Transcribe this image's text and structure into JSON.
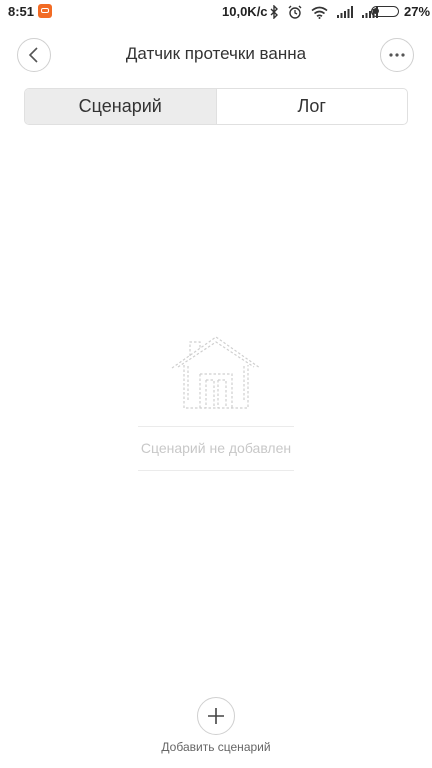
{
  "status_bar": {
    "time": "8:51",
    "network_speed": "10,0K/c",
    "battery_percent": "27%",
    "icons": [
      "app-notification-icon",
      "bluetooth-icon",
      "alarm-icon",
      "wifi-icon",
      "signal-icon",
      "signal-icon",
      "battery-icon"
    ]
  },
  "header": {
    "title": "Датчик протечки ванна",
    "back_icon": "chevron-left-icon",
    "more_icon": "more-dots-icon"
  },
  "tabs": [
    {
      "label": "Сценарий",
      "active": true
    },
    {
      "label": "Лог",
      "active": false
    }
  ],
  "empty_state": {
    "icon": "house-icon",
    "text": "Сценарий не добавлен"
  },
  "add_scenario": {
    "icon": "plus-icon",
    "label": "Добавить сценарий"
  },
  "colors": {
    "app_icon": "#f26b24",
    "tab_active_bg": "#ececec",
    "empty_text": "#c8c8c8"
  }
}
